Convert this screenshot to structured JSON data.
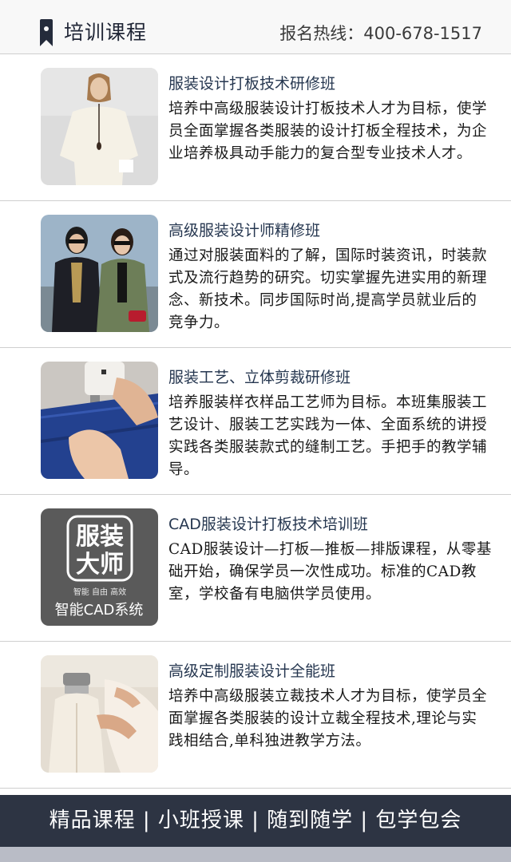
{
  "header": {
    "title": "培训课程",
    "hotline": "报名热线：400-678-1517"
  },
  "courses": [
    {
      "title": "服装设计打板技术研修班",
      "description": "培养中高级服装设计打板技术人才为目标，使学员全面掌握各类服装的设计打板全程技术，为企业培养极具动手能力的复合型专业技术人才。"
    },
    {
      "title": "高级服装设计师精修班",
      "description": "通过对服装面料的了解，国际时装资讯，时装款式及流行趋势的研究。切实掌握先进实用的新理念、新技术。同步国际时尚,提高学员就业后的竞争力。"
    },
    {
      "title": "服装工艺、立体剪裁研修班",
      "description": "培养服装样衣样品工艺师为目标。本班集服装工艺设计、服装工艺实践为一体、全面系统的讲授实践各类服装款式的缝制工艺。手把手的教学辅导。"
    },
    {
      "title": "CAD服装设计打板技术培训班",
      "description": "CAD服装设计—打板—推板—排版课程，从零基础开始，确保学员一次性成功。标准的CAD教室，学校备有电脑供学员使用。",
      "thumb_logo": {
        "line1": "服装",
        "line2": "大师",
        "tagline": "智能  自由  高效",
        "caption": "智能CAD系统"
      }
    },
    {
      "title": "高级定制服装设计全能班",
      "description": "培养中高级服装立裁技术人才为目标，使学员全面掌握各类服装的设计立裁全程技术,理论与实践相结合,单科独进教学方法。"
    }
  ],
  "banner": {
    "text": "精品课程 | 小班授课 | 随到随学 | 包学包会"
  },
  "colors": {
    "header_bg": "#f8f8f8",
    "title_dark": "#1f2535",
    "course_title": "#263750",
    "banner_bg": "#2d3443",
    "bottom_strip": "#b9bcc6"
  }
}
